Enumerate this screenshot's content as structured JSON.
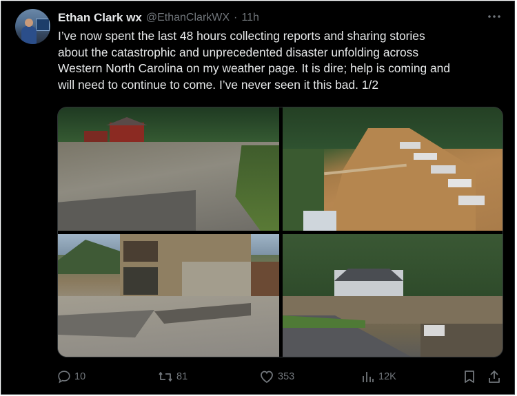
{
  "author": {
    "name": "Ethan Clark wx",
    "handle": "@EthanClarkWX",
    "separator": "·",
    "time": "11h"
  },
  "more_label": "•••",
  "tweet_text": "I’ve now spent the last 48 hours collecting reports and sharing stories\nabout the catastrophic and unprecedented disaster unfolding across\nWestern North Carolina on my weather page. It is dire; help is coming and\nwill need to continue to come. I’ve never seen it this bad. 1/2",
  "actions": {
    "replies": "10",
    "reposts": "81",
    "likes": "353",
    "views": "12K"
  },
  "icons": [
    "reply-icon",
    "repost-icon",
    "like-icon",
    "views-icon",
    "bookmark-icon",
    "share-icon",
    "more-icon"
  ],
  "colors": {
    "background": "#000000",
    "text": "#e7e9ea",
    "muted": "#71767b",
    "border": "#2f3336"
  }
}
